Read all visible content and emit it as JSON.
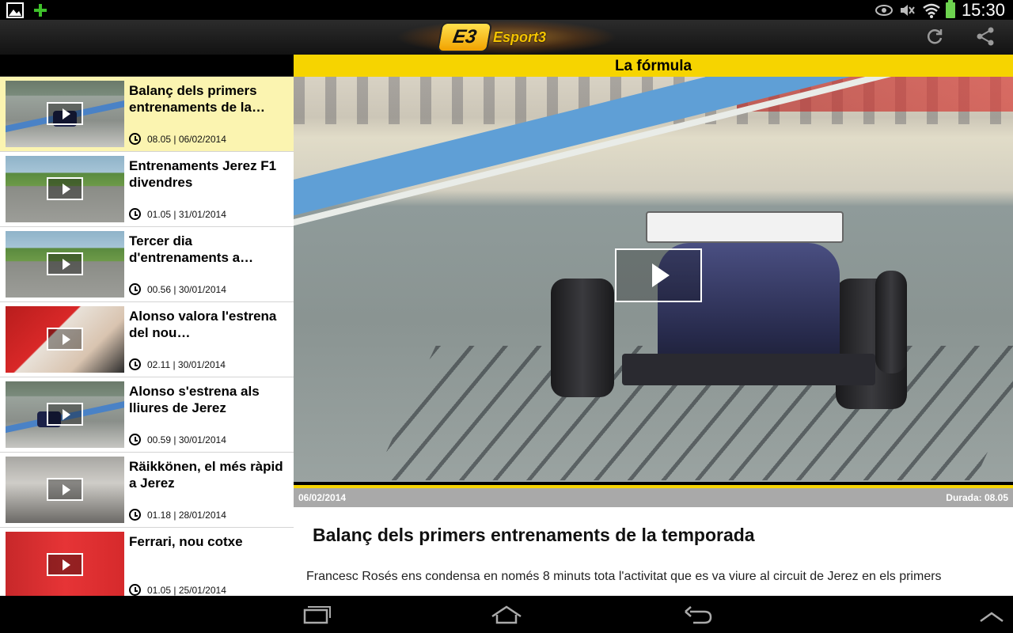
{
  "status_bar": {
    "time": "15:30",
    "left_icons": [
      "gallery-icon",
      "plus-icon"
    ],
    "right_icons": [
      "eye-icon",
      "mute-icon",
      "wifi-icon",
      "battery-icon"
    ],
    "colors": {
      "plus": "#3fc12b",
      "battery": "#6dd34f"
    }
  },
  "app": {
    "logo_text": "Esport3",
    "logo_badge": "E3",
    "actions": [
      "refresh-icon",
      "share-icon"
    ]
  },
  "category": {
    "title": "La fórmula",
    "color": "#f6d400"
  },
  "list": {
    "items": [
      {
        "title": "Balanç dels primers entrenaments de la…",
        "time": "08.05 | 06/02/2014",
        "selected": true
      },
      {
        "title": "Entrenaments Jerez F1 divendres",
        "time": "01.05 | 31/01/2014",
        "selected": false
      },
      {
        "title": "Tercer dia d'entrenaments a…",
        "time": "00.56 | 30/01/2014",
        "selected": false
      },
      {
        "title": "Alonso valora l'estrena del nou…",
        "time": "02.11 | 30/01/2014",
        "selected": false
      },
      {
        "title": "Alonso s'estrena als lliures de Jerez",
        "time": "00.59 | 30/01/2014",
        "selected": false
      },
      {
        "title": "Räikkönen, el més ràpid a Jerez",
        "time": "01.18 | 28/01/2014",
        "selected": false
      },
      {
        "title": "Ferrari, nou cotxe",
        "time": "01.05 | 25/01/2014",
        "selected": false
      }
    ]
  },
  "article": {
    "date": "06/02/2014",
    "duration": "Durada: 08.05",
    "title": "Balanç dels primers entrenaments de la temporada",
    "body": "Francesc Rosés ens condensa en només 8 minuts tota l'activitat que es va viure al circuit de Jerez en els primers"
  },
  "navigation": [
    "recent-apps-icon",
    "home-icon",
    "back-icon",
    "up-chevron-icon"
  ]
}
